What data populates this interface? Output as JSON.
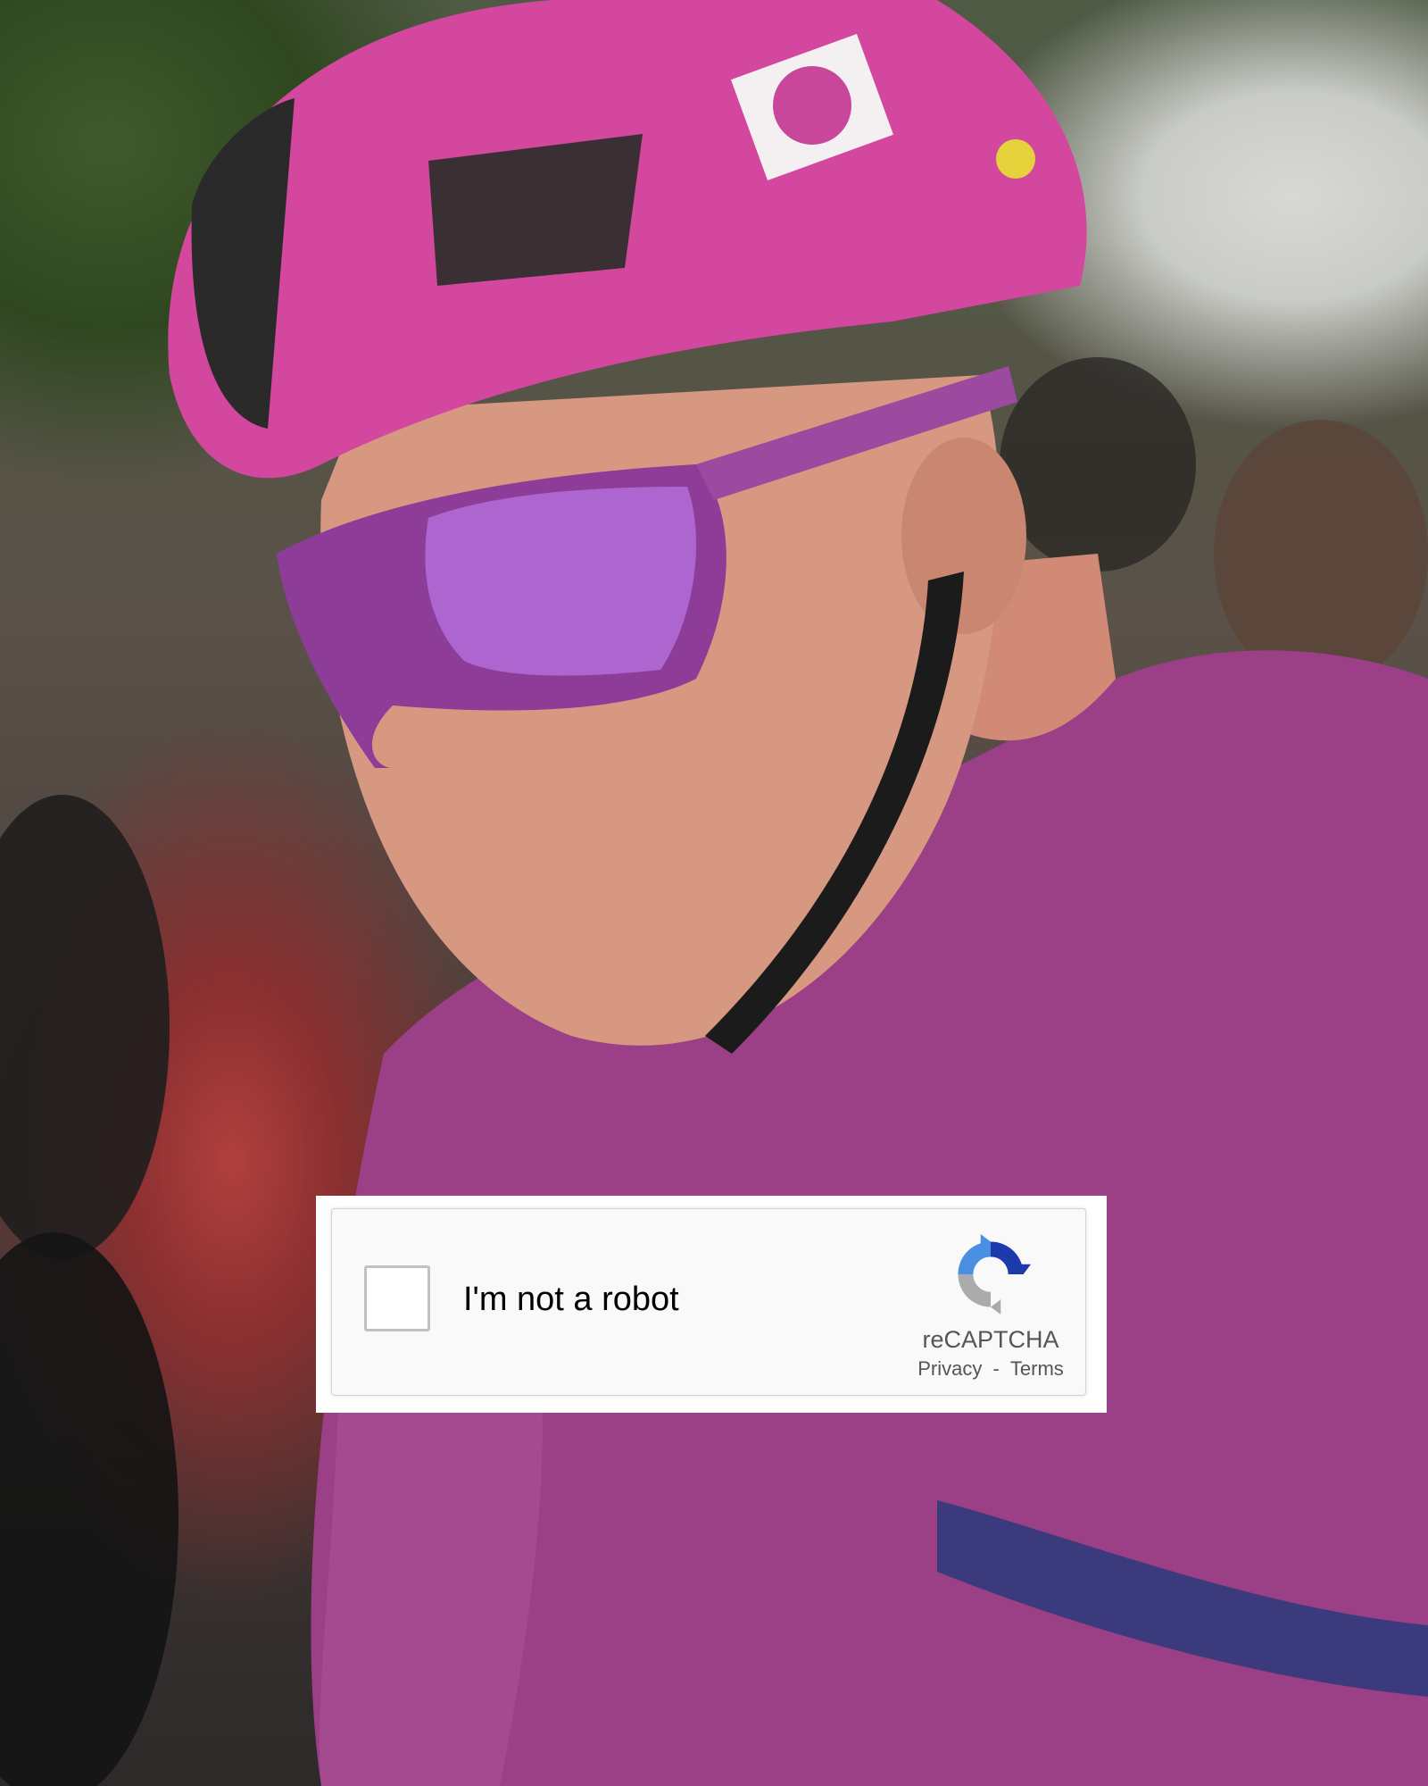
{
  "captcha": {
    "checkbox_label": "I'm not a robot",
    "brand": "reCAPTCHA",
    "privacy_link": "Privacy",
    "separator": "-",
    "terms_link": "Terms",
    "logo_icon": "recaptcha-logo-icon"
  },
  "colors": {
    "widget_bg": "#f9f9f9",
    "widget_border": "#d3d3d3",
    "checkbox_border": "#c1c1c1",
    "text": "#000000",
    "muted_text": "#555555",
    "recaptcha_blue": "#1c3aa9",
    "recaptcha_light_blue": "#4a90e2",
    "recaptcha_grey": "#ababab"
  }
}
